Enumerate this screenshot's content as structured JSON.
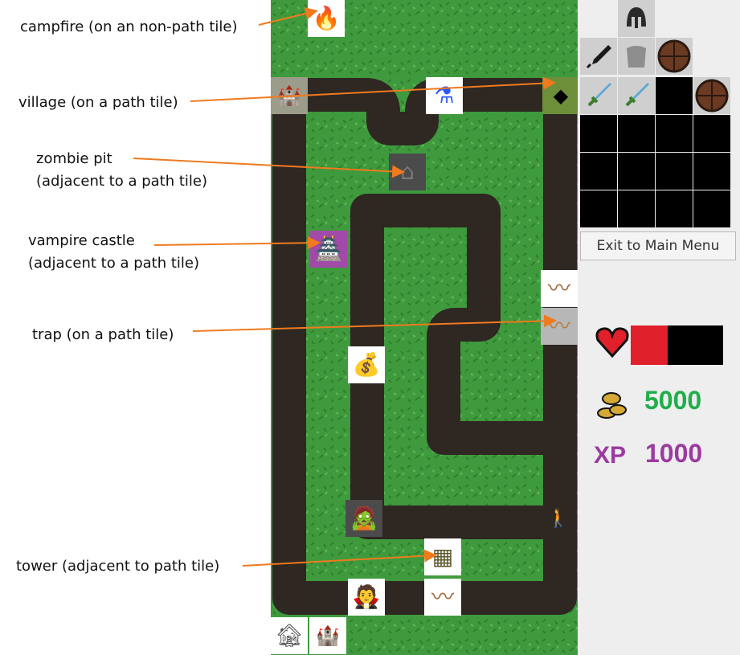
{
  "annotations": {
    "campfire": "campfire (on an non-path tile)",
    "village": "village (on a path tile)",
    "zombie_pit_line1": "zombie pit",
    "zombie_pit_line2": "(adjacent to a path tile)",
    "vampire_castle_line1": "vampire castle",
    "vampire_castle_line2": "(adjacent to a path tile)",
    "trap": "trap (on a path tile)",
    "tower": "tower (adjacent to path tile)"
  },
  "map_icons": {
    "campfire": "campfire-icon",
    "village": "village-icon",
    "potion": "potion-icon",
    "castle_start": "castle-icon",
    "zombie_pit": "zombie-pit-icon",
    "vampire_castle": "vampire-castle-icon",
    "trap": "trap-icon",
    "gold": "gold-icon",
    "zombie": "zombie-icon",
    "character": "character-icon",
    "tower": "tower-icon",
    "vampire": "vampire-icon",
    "barracks": "barracks-icon",
    "castle_card": "castle-card-icon"
  },
  "equipment": {
    "helmet": "helmet-icon",
    "sword": "sword-icon",
    "armour": "armour-icon",
    "shield": "shield-icon"
  },
  "inventory": {
    "items": [
      "sword-icon",
      "sword-icon",
      "empty",
      "shield-icon"
    ]
  },
  "menu": {
    "exit_label": "Exit to Main Menu"
  },
  "stats": {
    "health_fraction": 0.4,
    "gold": "5000",
    "xp_label": "XP",
    "xp": "1000"
  },
  "colors": {
    "grass": "#3f9a3d",
    "path": "#2e2722",
    "arrow": "#f07a1e",
    "health": "#e0202a",
    "gold_text": "#1fae4a",
    "xp_text": "#9b3aa0"
  }
}
